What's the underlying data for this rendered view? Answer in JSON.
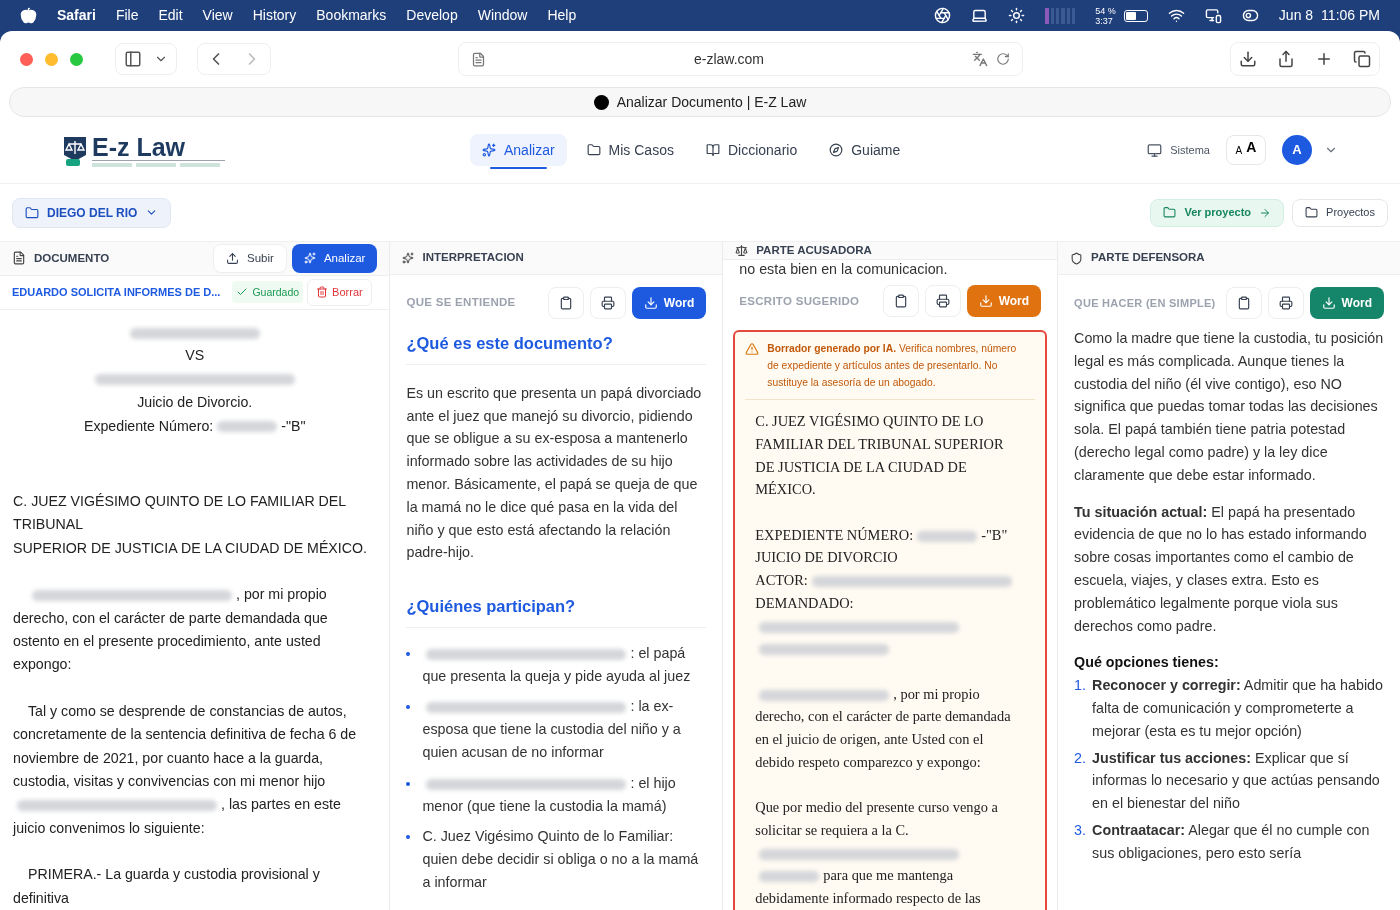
{
  "menu_bar": {
    "app": "Safari",
    "items": [
      "File",
      "Edit",
      "View",
      "History",
      "Bookmarks",
      "Develop",
      "Window",
      "Help"
    ],
    "battery_percent": "54 %",
    "battery_time": "3:37",
    "date": "Jun 8",
    "time": "11:06 PM"
  },
  "browser": {
    "url": "e-zlaw.com",
    "tab_title": "Analizar Documento | E-Z Law"
  },
  "app_header": {
    "logo": "E-z Law",
    "nav": [
      {
        "label": "Analizar",
        "selected": true
      },
      {
        "label": "Mis Casos",
        "selected": false
      },
      {
        "label": "Diccionario",
        "selected": false
      },
      {
        "label": "Guiame",
        "selected": false
      }
    ],
    "theme": "Sistema",
    "font_small": "A",
    "font_large": "A",
    "avatar": "A"
  },
  "project_bar": {
    "project": "DIEGO DEL RIO",
    "view_project": "Ver proyecto",
    "projects": "Proyectos"
  },
  "document_panel": {
    "title": "DOCUMENTO",
    "upload": "Subir",
    "analyze": "Analizar",
    "file_name": "EDUARDO SOLICITA INFORMES DE D...",
    "saved": "Guardado",
    "delete": "Borrar",
    "paragraphs": [
      {
        "kind": "centered",
        "parts": [
          {
            "kind": "redacted_short"
          }
        ]
      },
      {
        "kind": "centered",
        "parts": [
          {
            "kind": "text",
            "text": "VS"
          }
        ]
      },
      {
        "kind": "centered",
        "parts": [
          {
            "kind": "redacted_long"
          }
        ]
      },
      {
        "kind": "centered",
        "parts": [
          {
            "kind": "text",
            "text": "Juicio de Divorcio."
          }
        ]
      },
      {
        "kind": "centered",
        "parts": [
          {
            "kind": "text",
            "text": "Expediente Número:"
          },
          {
            "kind": "redacted_tiny"
          },
          {
            "kind": "text",
            "text": "-\"B\""
          }
        ]
      },
      {
        "kind": "heading",
        "parts": [
          {
            "kind": "text",
            "text": "C. JUEZ VIGÉSIMO QUINTO DE LO FAMILIAR DEL TRIBUNAL"
          }
        ]
      },
      {
        "kind": "heading",
        "parts": [
          {
            "kind": "text",
            "text": "SUPERIOR DE JUSTICIA DE LA CIUDAD DE MÉXICO."
          }
        ]
      },
      {
        "kind": "body",
        "parts": [
          {
            "kind": "redacted_long"
          },
          {
            "kind": "text",
            "text": ", por mi propio derecho, con el carácter de parte demandada que ostento en el presente procedimiento, ante usted expongo:"
          }
        ]
      },
      {
        "kind": "body",
        "parts": [
          {
            "kind": "text",
            "text": "Tal y como se desprende de constancias de autos, concretamente de la sentencia definitiva de fecha 6 de noviembre de 2021, por cuanto hace a la guarda, custodia, visitas y convivencias con mi menor hijo"
          },
          {
            "kind": "redacted_long"
          },
          {
            "kind": "text",
            "text": ", las partes en este juicio convenimos lo siguiente:"
          }
        ]
      },
      {
        "kind": "body",
        "parts": [
          {
            "kind": "text",
            "text": "PRIMERA.- La guarda y custodia provisional y definitiva"
          }
        ]
      }
    ]
  },
  "interpretation_panel": {
    "title": "INTERPRETACION",
    "section": "QUE SE ENTIENDE",
    "word": "Word",
    "heading_1": "¿Qué es este documento?",
    "summary": "Es un escrito que presenta un papá divorciado ante el juez que manejó su divorcio, pidiendo que se obligue a su ex-esposa a mantenerlo informado sobre las actividades de su hijo menor. Básicamente, el papá se queja de que la mamá no le dice qué pasa en la vida del niño y que esto está afectando la relación padre-hijo.",
    "heading_2": "¿Quiénes participan?",
    "participants": [
      {
        "parts": [
          {
            "kind": "redacted_long"
          },
          {
            "kind": "text",
            "text": ": el papá que presenta la queja y pide ayuda al juez"
          }
        ]
      },
      {
        "parts": [
          {
            "kind": "redacted_long"
          },
          {
            "kind": "text",
            "text": ": la ex-esposa que tiene la custodia del niño y a quien acusan de no informar"
          }
        ]
      },
      {
        "parts": [
          {
            "kind": "redacted_long"
          },
          {
            "kind": "text",
            "text": ": el hijo menor (que tiene la custodia la mamá)"
          }
        ]
      },
      {
        "parts": [
          {
            "kind": "text",
            "text": "C. Juez Vigésimo Quinto de lo Familiar: quien debe decidir si obliga o no a la mamá a informar"
          }
        ]
      }
    ]
  },
  "accuser_panel": {
    "title": "PARTE ACUSADORA",
    "top_text": "no esta bien en la comunicacion.",
    "section": "ESCRITO SUGERIDO",
    "word": "Word",
    "warning": "**Borrador generado por IA.** Verifica nombres, número de expediente y artículos antes de presentarlo. No sustituye la asesoría de un abogado.",
    "draft": [
      {
        "parts": [
          {
            "kind": "text",
            "text": "C. JUEZ VIGÉSIMO QUINTO DE LO FAMILIAR DEL TRIBUNAL SUPERIOR DE JUSTICIA DE LA CIUDAD DE MÉXICO."
          }
        ]
      },
      {
        "parts": [
          {
            "kind": "text",
            "text": "EXPEDIENTE NÚMERO:"
          },
          {
            "kind": "redacted_tiny"
          },
          {
            "kind": "text",
            "text": "-\"B\""
          }
        ]
      },
      {
        "parts": [
          {
            "kind": "text",
            "text": "JUICIO DE DIVORCIO"
          }
        ]
      },
      {
        "parts": [
          {
            "kind": "text",
            "text": "ACTOR:"
          },
          {
            "kind": "redacted_long"
          }
        ]
      },
      {
        "parts": [
          {
            "kind": "text",
            "text": "DEMANDADO:"
          },
          {
            "kind": "redacted_long"
          },
          {
            "kind": "redacted_short"
          }
        ]
      },
      {
        "parts": [
          {
            "kind": "redacted_short"
          },
          {
            "kind": "text",
            "text": ", por mi propio derecho, con el carácter de parte demandada en el juicio de origen, ante Usted con el debido respeto comparezco y expongo:"
          }
        ]
      },
      {
        "parts": [
          {
            "kind": "text",
            "text": "Que por medio del presente curso vengo a solicitar se requiera a la C."
          },
          {
            "kind": "redacted_long"
          },
          {
            "kind": "redacted_tiny"
          },
          {
            "kind": "text",
            "text": "para que me mantenga debidamente informado respecto de las"
          }
        ]
      }
    ]
  },
  "defense_panel": {
    "title": "PARTE DEFENSORA",
    "section": "QUE HACER (EN SIMPLE)",
    "word": "Word",
    "intro": "Como la madre que tiene la custodia, tu posición legal es más complicada. Aunque tienes la custodia del niño (él vive contigo), eso NO significa que puedas tomar todas las decisiones sola. El papá también tiene patria potestad (derecho legal como padre) y la ley dice claramente que debe estar informado.",
    "situation": "**Tu situación actual:** El papá ha presentado evidencia de que no lo has estado informando sobre cosas importantes como el cambio de escuela, viajes, y clases extra. Esto es problemático legalmente porque viola sus derechos como padre.",
    "options_heading": "Qué opciones tienes:",
    "options": [
      {
        "number": "1.",
        "text": "**Reconocer y corregir:** Admitir que ha habido falta de comunicación y comprometerte a mejorar (esta es tu mejor opción)"
      },
      {
        "number": "2.",
        "text": "**Justificar tus acciones:** Explicar que sí informas lo necesario y que actúas pensando en el bienestar del niño"
      },
      {
        "number": "3.",
        "text": "**Contraatacar:** Alegar que él no cumple con sus obligaciones, pero esto sería"
      }
    ]
  }
}
